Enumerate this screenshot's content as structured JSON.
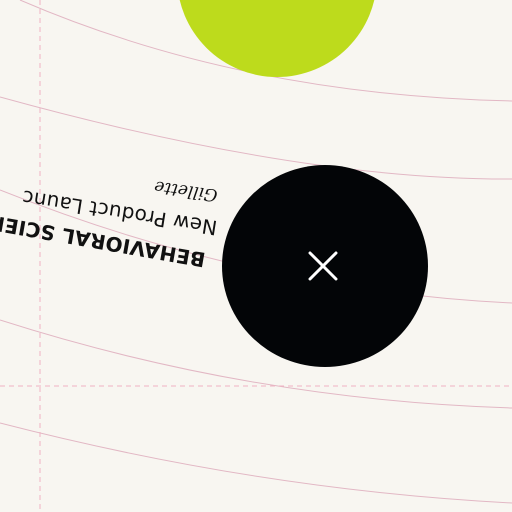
{
  "card": {
    "title": "BEHAVIORAL SCIEN",
    "subtitle": "New Product Launc",
    "brand": "Gillette"
  },
  "colors": {
    "background": "#f8f6f1",
    "accent_lime": "#bddb1c",
    "dark_circle": "#030507",
    "guide_line": "#e2b7c4"
  },
  "icons": {
    "close": "close-icon"
  }
}
